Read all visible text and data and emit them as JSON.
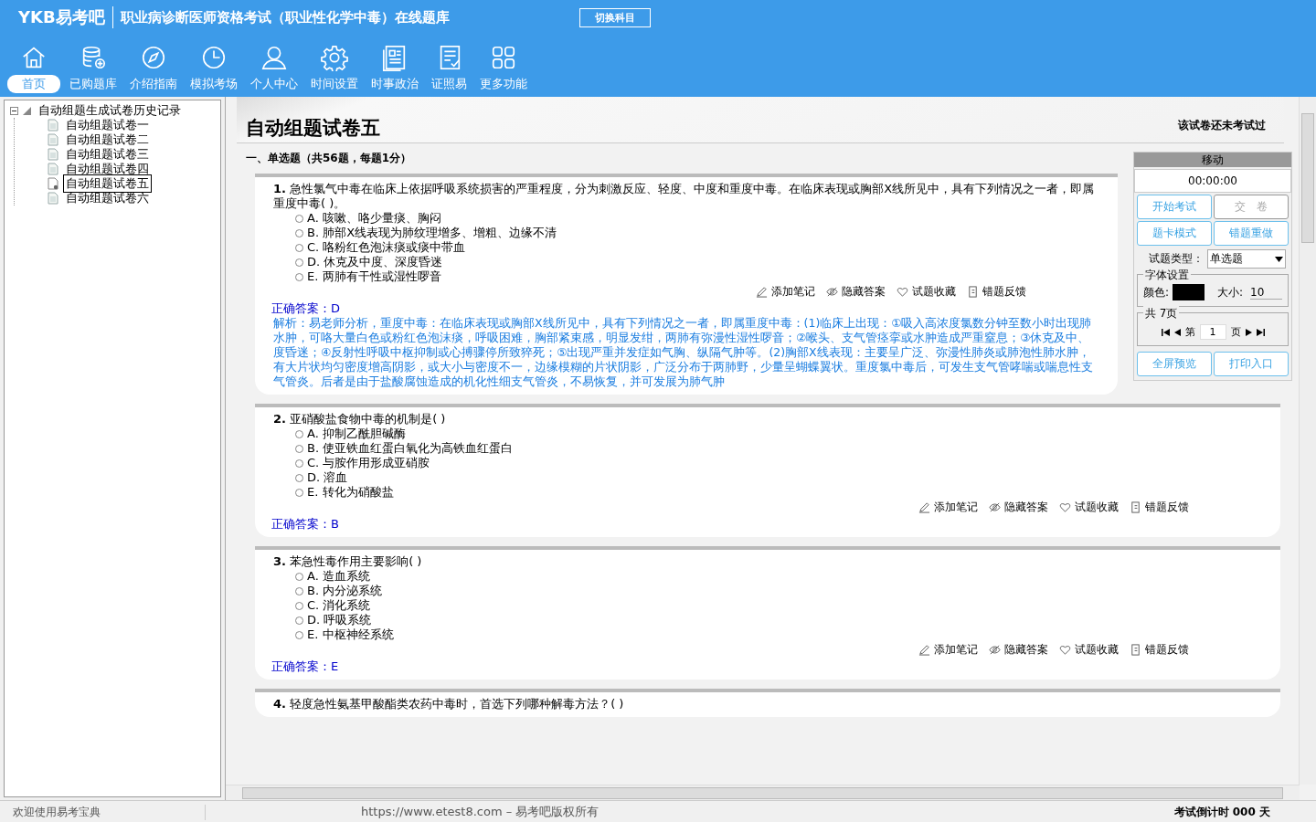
{
  "header": {
    "logo": "YKB易考吧",
    "title": "职业病诊断医师资格考试（职业性化学中毒）在线题库",
    "switch_button": "切换科目"
  },
  "nav": [
    {
      "label": "首页",
      "selected": true
    },
    {
      "label": "已购题库",
      "selected": false
    },
    {
      "label": "介绍指南",
      "selected": false
    },
    {
      "label": "模拟考场",
      "selected": false
    },
    {
      "label": "个人中心",
      "selected": false
    },
    {
      "label": "时间设置",
      "selected": false
    },
    {
      "label": "时事政治",
      "selected": false
    },
    {
      "label": "证照易",
      "selected": false
    },
    {
      "label": "更多功能",
      "selected": false
    }
  ],
  "tree": {
    "label": "自动组题生成试卷历史记录",
    "expanded": true,
    "children": [
      {
        "label": "自动组题试卷一",
        "selected": false
      },
      {
        "label": "自动组题试卷二",
        "selected": false
      },
      {
        "label": "自动组题试卷三",
        "selected": false
      },
      {
        "label": "自动组题试卷四",
        "selected": false
      },
      {
        "label": "自动组题试卷五",
        "selected": true
      },
      {
        "label": "自动组题试卷六",
        "selected": false
      }
    ]
  },
  "exam": {
    "title": "自动组题试卷五",
    "status": "该试卷还未考试过",
    "section": "一、单选题（共56题，每题1分）",
    "questions": [
      {
        "number": "1.",
        "stem": "急性氯气中毒在临床上依据呼吸系统损害的严重程度，分为刺激反应、轻度、中度和重度中毒。在临床表现或胸部X线所见中，具有下列情况之一者，即属重度中毒( )。",
        "options": [
          {
            "letter": "A.",
            "text": "咳嗽、咯少量痰、胸闷",
            "selected": false
          },
          {
            "letter": "B.",
            "text": "肺部X线表现为肺纹理增多、增粗、边缘不清",
            "selected": false
          },
          {
            "letter": "C.",
            "text": "咯粉红色泡沫痰或痰中带血",
            "selected": false
          },
          {
            "letter": "D.",
            "text": "休克及中度、深度昏迷",
            "selected": false
          },
          {
            "letter": "E.",
            "text": "两肺有干性或湿性啰音",
            "selected": false
          }
        ],
        "actions": [
          "添加笔记",
          "隐藏答案",
          "试题收藏",
          "错题反馈"
        ],
        "answer_label": "正确答案：",
        "answer": "D",
        "explanation": "解析：易老师分析，重度中毒：在临床表现或胸部X线所见中，具有下列情况之一者，即属重度中毒：(1)临床上出现：①吸入高浓度氯数分钟至数小时出现肺水肿，可咯大量白色或粉红色泡沫痰，呼吸困难，胸部紧束感，明显发绀，两肺有弥漫性湿性啰音；②喉头、支气管痉挛或水肿造成严重窒息；③休克及中、度昏迷；④反射性呼吸中枢抑制或心搏骤停所致猝死；⑤出现严重并发症如气胸、纵隔气肿等。(2)胸部X线表现：主要呈广泛、弥漫性肺炎或肺泡性肺水肿，有大片状均匀密度增高阴影，或大小与密度不一，边缘模糊的片状阴影，广泛分布于两肺野，少量呈蝴蝶翼状。重度氯中毒后，可发生支气管哮喘或喘息性支气管炎。后者是由于盐酸腐蚀造成的机化性细支气管炎，不易恢复，并可发展为肺气肿"
      },
      {
        "number": "2.",
        "stem": "亚硝酸盐食物中毒的机制是( )",
        "options": [
          {
            "letter": "A.",
            "text": "抑制乙酰胆碱酶",
            "selected": false
          },
          {
            "letter": "B.",
            "text": "使亚铁血红蛋白氧化为高铁血红蛋白",
            "selected": false
          },
          {
            "letter": "C.",
            "text": "与胺作用形成亚硝胺",
            "selected": false
          },
          {
            "letter": "D.",
            "text": "溶血",
            "selected": false
          },
          {
            "letter": "E.",
            "text": "转化为硝酸盐",
            "selected": false
          }
        ],
        "actions": [
          "添加笔记",
          "隐藏答案",
          "试题收藏",
          "错题反馈"
        ],
        "answer_label": "正确答案：",
        "answer": "B"
      },
      {
        "number": "3.",
        "stem": "苯急性毒作用主要影响( )",
        "options": [
          {
            "letter": "A.",
            "text": "造血系统",
            "selected": false
          },
          {
            "letter": "B.",
            "text": "内分泌系统",
            "selected": false
          },
          {
            "letter": "C.",
            "text": "消化系统",
            "selected": false
          },
          {
            "letter": "D.",
            "text": "呼吸系统",
            "selected": false
          },
          {
            "letter": "E.",
            "text": "中枢神经系统",
            "selected": false
          }
        ],
        "actions": [
          "添加笔记",
          "隐藏答案",
          "试题收藏",
          "错题反馈"
        ],
        "answer_label": "正确答案：",
        "answer": "E"
      },
      {
        "number": "4.",
        "stem": "轻度急性氨基甲酸酯类农药中毒时，首选下列哪种解毒方法？( )"
      }
    ]
  },
  "panel": {
    "header": "移动",
    "timer": "00:00:00",
    "buttons": [
      {
        "label": "开始考试",
        "disabled": false
      },
      {
        "label": "交　卷",
        "disabled": true
      },
      {
        "label": "题卡模式",
        "disabled": false
      },
      {
        "label": "错题重做",
        "disabled": false
      }
    ],
    "type_label": "试题类型：",
    "type_value": "单选题",
    "font_group": "字体设置",
    "color_label": "颜色:",
    "color": "#000000",
    "size_label": "大小:",
    "size": "10",
    "pages_group": "共 7页",
    "page_prefix": "第",
    "page": "1",
    "page_suffix": "页",
    "bottom_buttons": [
      "全屏预览",
      "打印入口"
    ]
  },
  "status_bar": {
    "welcome": "欢迎使用易考宝典",
    "copyright": "https://www.etest8.com – 易考吧版权所有",
    "countdown": "考试倒计时 000 天"
  }
}
